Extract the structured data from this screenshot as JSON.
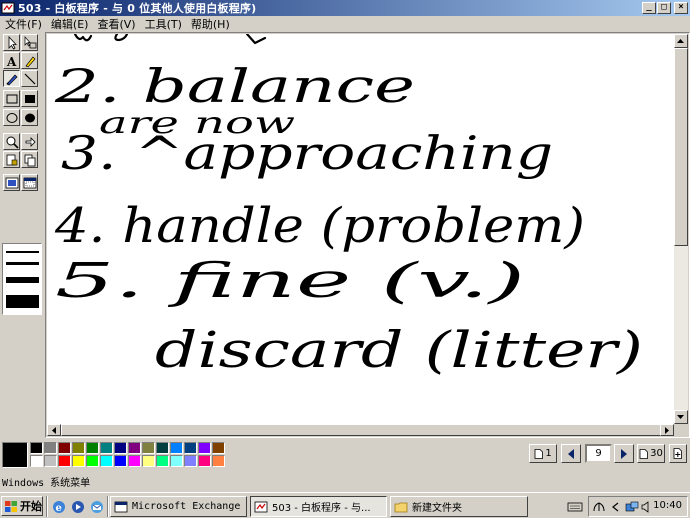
{
  "window": {
    "title": "503 - 白板程序 - 与 0 位其他人使用白板程序)",
    "buttons": {
      "minimize": "_",
      "maximize": "□",
      "close": "×"
    }
  },
  "menu": {
    "items": [
      {
        "label": "文件(F)"
      },
      {
        "label": "编辑(E)"
      },
      {
        "label": "查看(V)"
      },
      {
        "label": "工具(T)"
      },
      {
        "label": "帮助(H)"
      }
    ]
  },
  "toolbox": {
    "tools": [
      {
        "icon": "select-arrow-icon"
      },
      {
        "icon": "zoom-select-icon"
      },
      {
        "icon": "text-tool-icon"
      },
      {
        "icon": "highlighter-icon"
      },
      {
        "icon": "pen-icon",
        "selected": true
      },
      {
        "icon": "line-icon"
      },
      {
        "icon": "hollow-rectangle-icon"
      },
      {
        "icon": "filled-rectangle-icon"
      },
      {
        "icon": "hollow-ellipse-icon"
      },
      {
        "icon": "filled-ellipse-icon"
      },
      {
        "icon": "zoom-icon"
      },
      {
        "icon": "remote-pointer-icon"
      },
      {
        "icon": "lock-contents-icon"
      },
      {
        "icon": "synchronize-icon"
      },
      {
        "icon": "select-area-icon"
      },
      {
        "icon": "select-window-icon"
      }
    ],
    "line_widths": [
      "thin",
      "medium",
      "thick",
      "extra-thick"
    ]
  },
  "canvas": {
    "handwriting": [
      "2. balance",
      "are now",
      "3. ^approaching",
      "4. handle (problem)",
      "5. fine (v.)",
      "discard (litter)"
    ]
  },
  "palette": {
    "current_color": "#000000",
    "colors_row1": [
      "#000000",
      "#808080",
      "#800000",
      "#808000",
      "#008000",
      "#008080",
      "#000080",
      "#800080",
      "#808040",
      "#004040",
      "#0080ff",
      "#004080",
      "#8000ff",
      "#804000"
    ],
    "colors_row2": [
      "#ffffff",
      "#c0c0c0",
      "#ff0000",
      "#ffff00",
      "#00ff00",
      "#00ffff",
      "#0000ff",
      "#ff00ff",
      "#ffff80",
      "#00ff80",
      "#80ffff",
      "#8080ff",
      "#ff0080",
      "#ff8040"
    ]
  },
  "page_nav": {
    "first_page": "1",
    "current_page": "9",
    "last_page": "30"
  },
  "status": {
    "text": "Windows 系统菜单"
  },
  "taskbar": {
    "start_label": "开始",
    "tasks": [
      {
        "label": "Microsoft Exchange ...",
        "active": false
      },
      {
        "label": "503 - 白板程序 - 与...",
        "active": true
      },
      {
        "label": "新建文件夹",
        "active": false
      }
    ],
    "clock": "10:40"
  }
}
